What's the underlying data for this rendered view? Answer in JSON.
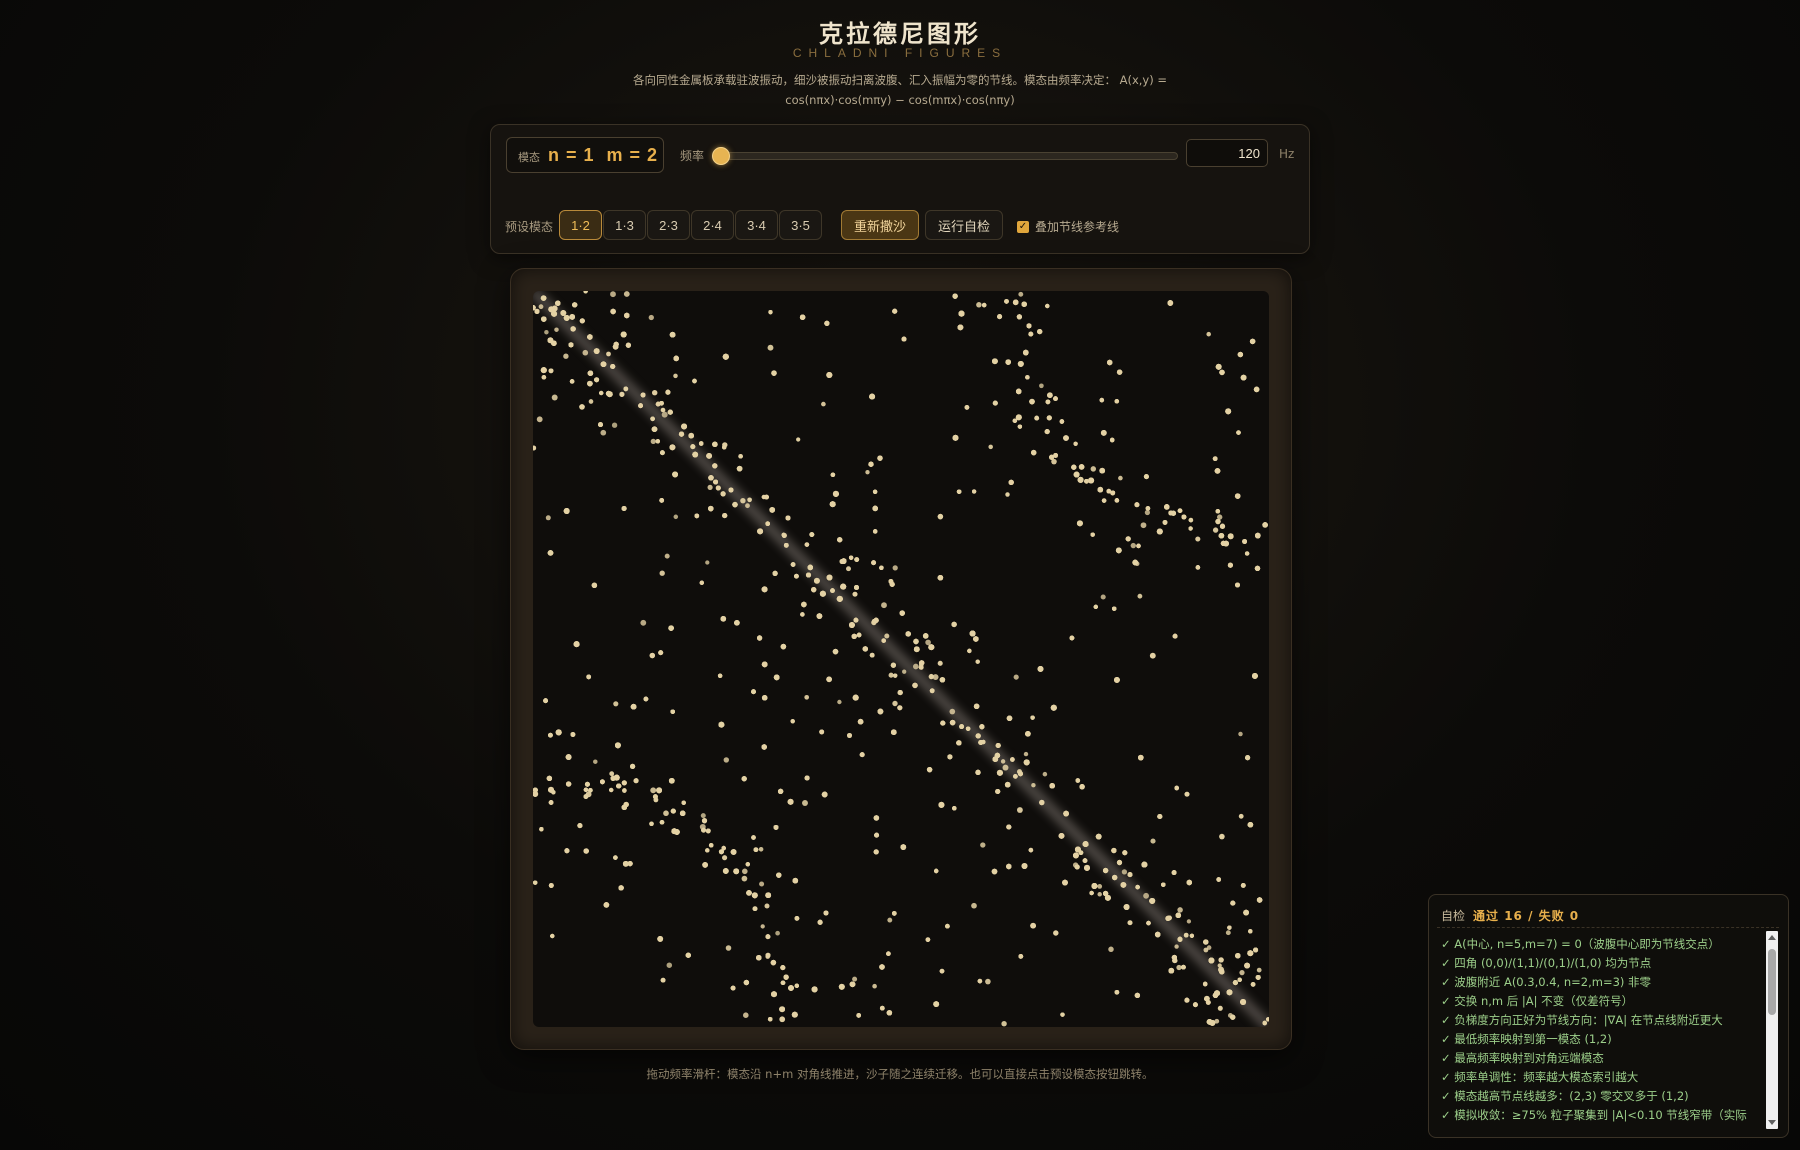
{
  "header": {
    "title": "克拉德尼图形",
    "subtitle": "CHLADNI FIGURES",
    "description_line1": "各向同性金属板承载驻波振动，细沙被振动扫离波腹、汇入振幅为零的节线。模态由频率决定：  A(x,y) =",
    "description_line2": "cos(nπx)·cos(mπy) − cos(mπx)·cos(nπy)"
  },
  "controls": {
    "mode_label": "模态",
    "mode_n": "n = 1",
    "mode_m": "m = 2",
    "freq_label": "频率",
    "freq_value": "120",
    "freq_unit": "Hz",
    "slider_fraction": 0.0,
    "preset_label": "预设模态",
    "presets": [
      "1·2",
      "1·3",
      "2·3",
      "2·4",
      "3·4",
      "3·5"
    ],
    "active_preset": 0,
    "reset_button": "重新撒沙",
    "selftest_button": "运行自检",
    "nodal_checkbox_label": "叠加节线参考线",
    "nodal_checked": true
  },
  "plate": {
    "n": 1,
    "m": 2,
    "sand_color": "#e3d1a4",
    "nodal_line_color": "#9a9088"
  },
  "hint": "拖动频率滑杆：模态沿 n+m 对角线推进，沙子随之连续迁移。也可以直接点击预设模态按钮跳转。",
  "selftest": {
    "label": "自检",
    "summary": "通过 16 / 失败 0",
    "items": [
      "✓ A(中心, n=5,m=7) = 0（波腹中心即为节线交点）",
      "✓ 四角 (0,0)/(1,1)/(0,1)/(1,0) 均为节点",
      "✓ 波腹附近 A(0.3,0.4, n=2,m=3) 非零",
      "✓ 交换 n,m 后 |A| 不变（仅差符号）",
      "✓ 负梯度方向正好为节线方向：|∇A| 在节点线附近更大",
      "✓ 最低频率映射到第一模态 (1,2)",
      "✓ 最高频率映射到对角远端模态",
      "✓ 频率单调性：频率越大模态索引越大",
      "✓ 模态越高节点线越多：(2,3) 零交叉多于 (1,2)",
      "✓ 模拟收敛：≥75% 粒子聚集到 |A|<0.10 节线窄带（实际"
    ]
  }
}
